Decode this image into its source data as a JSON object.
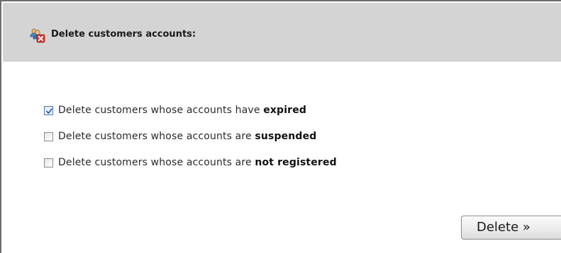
{
  "header": {
    "title": "Delete customers accounts:",
    "icon": "delete-customers-icon"
  },
  "options": [
    {
      "prefix": "Delete customers whose accounts have ",
      "emphasis": "expired",
      "checked": true
    },
    {
      "prefix": "Delete customers whose accounts are ",
      "emphasis": "suspended",
      "checked": false
    },
    {
      "prefix": "Delete customers whose accounts are ",
      "emphasis": "not registered",
      "checked": false
    }
  ],
  "actions": {
    "delete_label": "Delete »"
  },
  "colors": {
    "header_bg": "#d4d4d4",
    "check_accent": "#4a78b8",
    "delete_badge": "#d9342b"
  }
}
